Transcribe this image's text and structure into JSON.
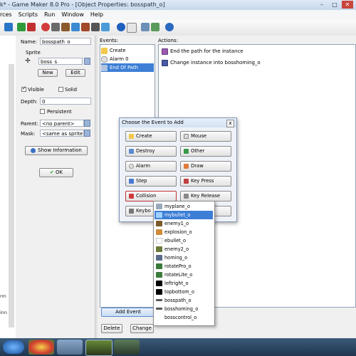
{
  "window": {
    "title": "k* - Game Maker 8.0 Pro - [Object Properties: bosspath_o]",
    "minimize_label": "–",
    "maximize_label": "□",
    "close_label": "✕"
  },
  "menu": [
    "rces",
    "Scripts",
    "Run",
    "Window",
    "Help"
  ],
  "sidebar": {
    "text_upper": "rm",
    "text_lower": "inn"
  },
  "properties": {
    "name_label": "Name:",
    "name_value": "bosspath_o",
    "sprite_label": "Sprite",
    "sprite_value": "boss_s",
    "new_label": "New",
    "edit_label": "Edit",
    "visible_label": "Visible",
    "solid_label": "Solid",
    "depth_label": "Depth:",
    "depth_value": "0",
    "persistent_label": "Persistent",
    "parent_label": "Parent:",
    "parent_value": "<no parent>",
    "mask_label": "Mask:",
    "mask_value": "<same as sprite>",
    "show_info_label": "Show Information",
    "ok_label": "OK"
  },
  "events": {
    "header": "Events:",
    "items": [
      "Create",
      "Alarm 0",
      "End Of Path"
    ],
    "add_event_label": "Add Event",
    "delete_label": "Delete",
    "change_label": "Change"
  },
  "actions": {
    "header": "Actions:",
    "items": [
      "End the path for the instance",
      "Change instance into bosshoming_o"
    ]
  },
  "dialog": {
    "title": "Choose the Event to Add",
    "close_label": "x",
    "buttons": [
      "Create",
      "Mouse",
      "Destroy",
      "Other",
      "Alarm",
      "Draw",
      "Step",
      "Key Press",
      "Collision",
      "Key Release",
      "Keybo"
    ]
  },
  "popup": {
    "items": [
      "myplane_o",
      "mybullet_o",
      "enemy1_o",
      "explosion_o",
      "ebullet_o",
      "enemy2_o",
      "homing_o",
      "rotatePro_o",
      "rotateLite_o",
      "leftright_o",
      "topbottom_o",
      "bosspath_o",
      "bosshoming_o",
      "bosscontrol_o"
    ]
  },
  "colors": {
    "selection": "#3d7fd6",
    "taskbar": "#1f3650",
    "dialog_bg": "#eef2f8"
  }
}
